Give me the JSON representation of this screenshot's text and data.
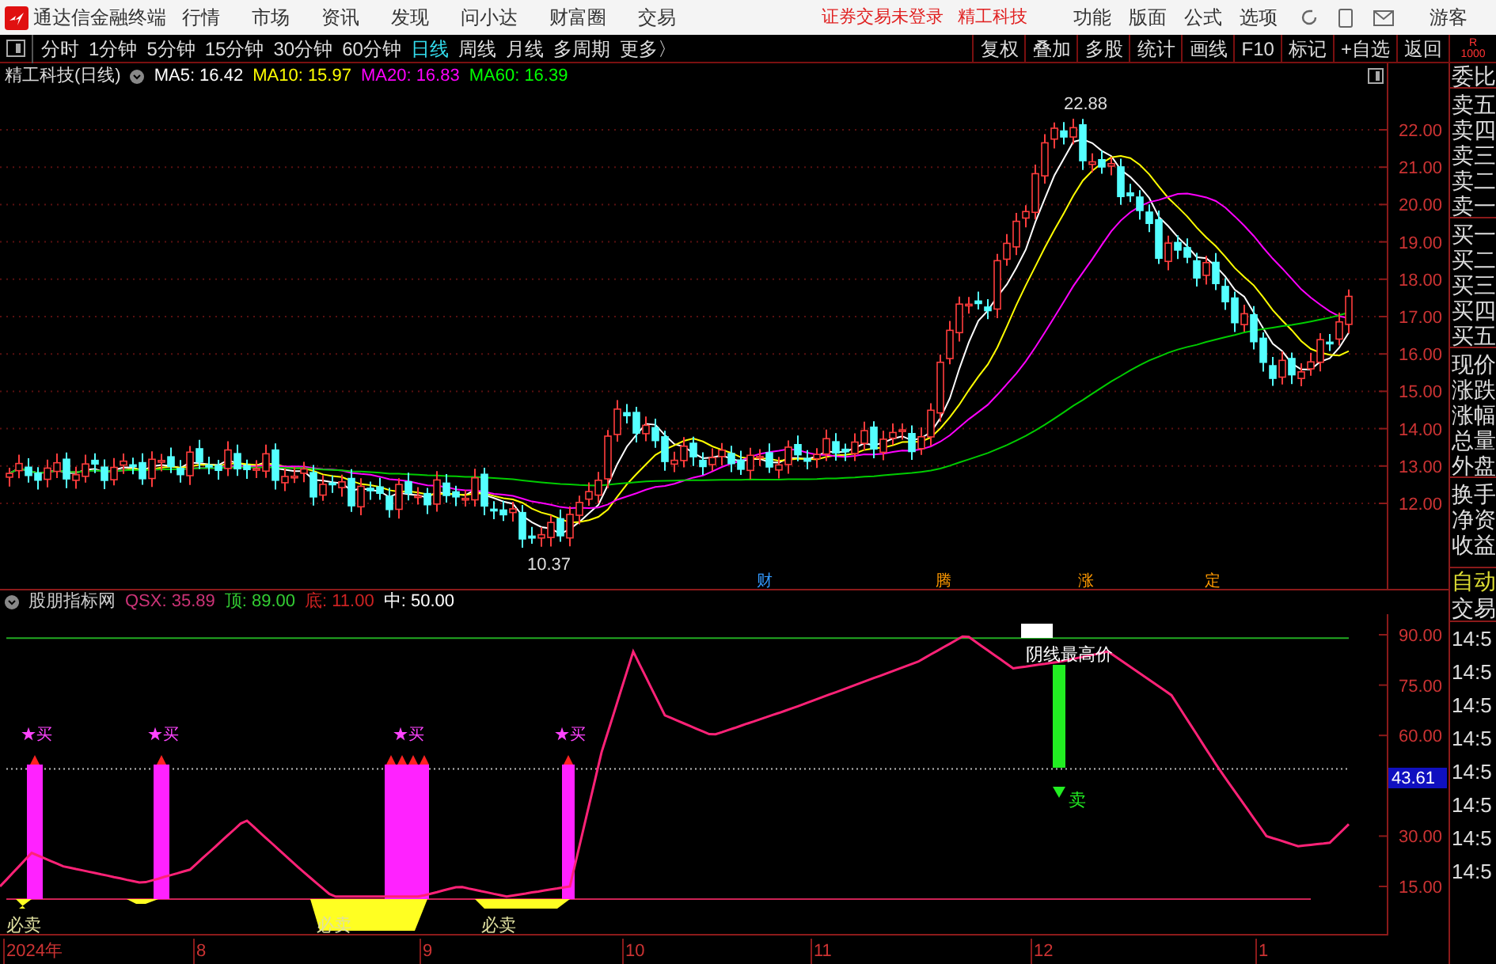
{
  "app": {
    "title": "通达信金融终端",
    "menu": [
      "行情",
      "市场",
      "资讯",
      "发现",
      "问小达",
      "财富圈",
      "交易"
    ],
    "notice": "证券交易未登录",
    "stock_name": "精工科技",
    "tools": [
      "功能",
      "版面",
      "公式",
      "选项"
    ],
    "user": "游客"
  },
  "periods": [
    {
      "label": "分时",
      "selected": false
    },
    {
      "label": "1分钟",
      "selected": false
    },
    {
      "label": "5分钟",
      "selected": false
    },
    {
      "label": "15分钟",
      "selected": false
    },
    {
      "label": "30分钟",
      "selected": false
    },
    {
      "label": "60分钟",
      "selected": false
    },
    {
      "label": "日线",
      "selected": true
    },
    {
      "label": "周线",
      "selected": false
    },
    {
      "label": "月线",
      "selected": false
    },
    {
      "label": "多周期",
      "selected": false
    },
    {
      "label": "更多〉",
      "selected": false
    }
  ],
  "actions": [
    "复权",
    "叠加",
    "多股",
    "统计",
    "画线",
    "F10",
    "标记",
    "+自选",
    "返回"
  ],
  "corner": [
    "R",
    "1000"
  ],
  "main_chart": {
    "title": "精工科技(日线)",
    "legend": [
      {
        "label": "MA5: 16.42",
        "color": "#ffffff"
      },
      {
        "label": "MA10: 15.97",
        "color": "#ffff00"
      },
      {
        "label": "MA20: 16.83",
        "color": "#ff00ff"
      },
      {
        "label": "MA60: 16.39",
        "color": "#00ff00"
      }
    ],
    "high_label": "22.88",
    "low_label": "10.37",
    "events": [
      {
        "label": "财",
        "color": "#3399ff"
      },
      {
        "label": "腾",
        "color": "#ff9900"
      },
      {
        "label": "涨",
        "color": "#ff9900"
      },
      {
        "label": "定",
        "color": "#ff9900"
      }
    ],
    "y_labels": [
      "22.00",
      "21.00",
      "20.00",
      "19.00",
      "18.00",
      "17.00",
      "16.00",
      "15.00",
      "14.00",
      "13.00",
      "12.00"
    ]
  },
  "indicator": {
    "name": "股朋指标网",
    "legend": [
      {
        "label": "QSX: 35.89",
        "color": "#cc3377"
      },
      {
        "label": "顶: 89.00",
        "color": "#33cc33"
      },
      {
        "label": "底: 11.00",
        "color": "#cc2222"
      },
      {
        "label": "中: 50.00",
        "color": "#ffffff"
      }
    ],
    "y_labels": [
      "90.00",
      "75.00",
      "60.00",
      "30.00",
      "15.00"
    ],
    "current": "43.61",
    "buy_labels": [
      "★买",
      "★买",
      "★买",
      "★买"
    ],
    "sell_labels": [
      "必卖",
      "必卖",
      "必卖"
    ],
    "sell_signal": "卖",
    "high_note": "阴线最高价"
  },
  "x_labels": [
    "2024年",
    "8",
    "9",
    "10",
    "11",
    "12",
    "1"
  ],
  "quote_panel": {
    "rows": [
      "委比",
      "卖五",
      "卖四",
      "卖三",
      "卖二",
      "卖一",
      "买一",
      "买二",
      "买三",
      "买四",
      "买五",
      "现价",
      "涨跌",
      "涨幅",
      "总量",
      "外盘",
      "换手",
      "净资",
      "收益"
    ],
    "auto": "自动",
    "trade": "交易",
    "times": [
      "14:5",
      "14:5",
      "14:5",
      "14:5",
      "14:5",
      "14:5",
      "14:5",
      "14:5"
    ]
  }
}
